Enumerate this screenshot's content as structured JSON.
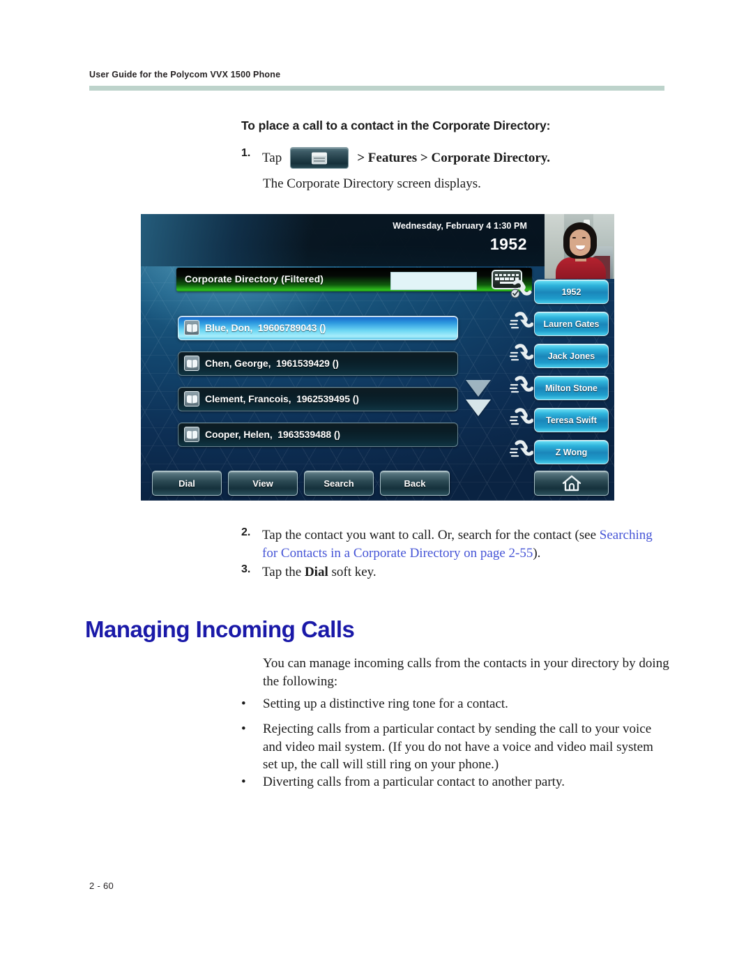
{
  "header": {
    "running_head": "User Guide for the Polycom VVX 1500 Phone"
  },
  "procedure": {
    "heading": "To place a call to a contact in the Corporate Directory:",
    "step1": {
      "number": "1.",
      "lead": "Tap",
      "icon": "menu-window-icon",
      "path": "> Features > Corporate Directory.",
      "result": "The Corporate Directory screen displays."
    },
    "step2": {
      "number": "2.",
      "part1": "Tap the contact you want to call. Or, search for the contact (see ",
      "link": "Searching for Contacts in a Corporate Directory",
      "part2": " on page ",
      "page_ref": "2-55",
      "part3": ")."
    },
    "step3": {
      "number": "3.",
      "part1": "Tap the ",
      "bold": "Dial",
      "part2": " soft key."
    }
  },
  "phone_screen": {
    "status": {
      "datetime": "Wednesday, February 4  1:30 PM",
      "extension": "1952"
    },
    "directory": {
      "title": "Corporate Directory (Filtered)",
      "search_value": "",
      "search_placeholder": "",
      "keyboard_icon": "keyboard-icon"
    },
    "contacts": [
      {
        "name": "Blue, Don,",
        "number": "19606789043 ()",
        "selected": true
      },
      {
        "name": "Chen, George,",
        "number": "1961539429 ()",
        "selected": false
      },
      {
        "name": "Clement, Francois,",
        "number": "1962539495 ()",
        "selected": false
      },
      {
        "name": "Cooper, Helen,",
        "number": "1963539488 ()",
        "selected": false
      }
    ],
    "line_keys": [
      {
        "label": "1952",
        "icon": "handset-registered-icon"
      },
      {
        "label": "Lauren Gates",
        "icon": "handset-icon"
      },
      {
        "label": "Jack Jones",
        "icon": "handset-icon"
      },
      {
        "label": "Milton Stone",
        "icon": "handset-icon"
      },
      {
        "label": "Teresa Swift",
        "icon": "handset-icon"
      },
      {
        "label": "Z Wong",
        "icon": "handset-icon"
      }
    ],
    "soft_keys": [
      {
        "label": "Dial"
      },
      {
        "label": "View"
      },
      {
        "label": "Search"
      },
      {
        "label": "Back"
      }
    ],
    "home_key": {
      "icon": "home-icon",
      "label": ""
    },
    "scroll_indicator": "chevron-down-icon",
    "colors": {
      "screen_blue": "#12456d",
      "title_bar_green": "#31c21e",
      "selected_row": "#6fd8f4",
      "line_key": "#2fb4dc"
    }
  },
  "section": {
    "heading": "Managing Incoming Calls",
    "intro": "You can manage incoming calls from the contacts in your directory by doing the following:",
    "bullets": [
      "Setting up a distinctive ring tone for a contact.",
      "Rejecting calls from a particular contact by sending the call to your voice and video mail system. (If you do not have a voice and video mail system set up, the call will still ring on your phone.)",
      "Diverting calls from a particular contact to another party."
    ],
    "bullet_marker": "•"
  },
  "footer": {
    "page_number": "2 - 60"
  },
  "colors": {
    "heading_blue": "#1a19a8",
    "link_blue": "#4554d6",
    "header_rule": "#bdd3cb"
  }
}
